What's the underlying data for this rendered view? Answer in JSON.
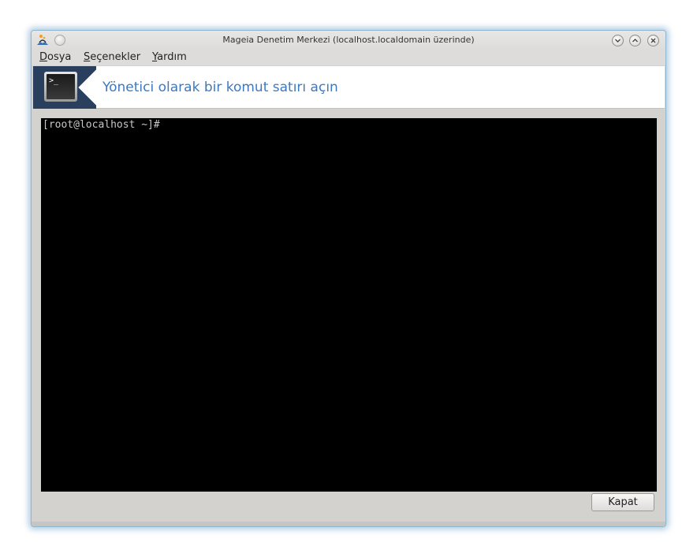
{
  "window": {
    "title": "Mageia Denetim Merkezi  (localhost.localdomain üzerinde)",
    "controls": [
      "minimize-icon",
      "maximize-icon",
      "close-icon"
    ]
  },
  "menubar": {
    "items": [
      {
        "underline": "D",
        "rest": "osya"
      },
      {
        "underline": "S",
        "rest": "eçenekler"
      },
      {
        "underline": "Y",
        "rest": "ardım"
      }
    ]
  },
  "banner": {
    "icon": "terminal-icon",
    "icon_glyph": ">_",
    "title": "Yönetici olarak bir komut satırı açın",
    "accent_color": "#3b79c2",
    "icon_bg_color": "#2a3e5e"
  },
  "terminal": {
    "prompt": "[root@localhost ~]#",
    "bg_color": "#000000"
  },
  "footer": {
    "close_label": "Kapat"
  }
}
